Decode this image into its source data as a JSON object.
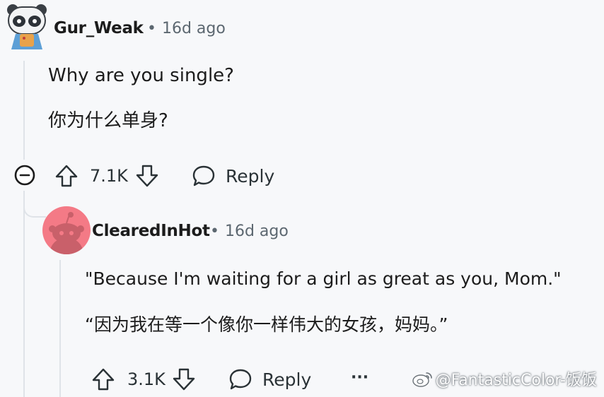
{
  "comment1": {
    "username": "Gur_Weak",
    "time": "16d ago",
    "text_en": "Why are you single?",
    "text_zh": "你为什么单身?",
    "upvotes": "7.1K",
    "reply_label": "Reply"
  },
  "comment2": {
    "username": "ClearedInHot",
    "time": "16d ago",
    "text_en": "\"Because I'm waiting for a girl as great as you, Mom.\"",
    "text_zh": "“因为我在等一个像你一样伟大的女孩，妈妈。”",
    "upvotes": "3.1K",
    "reply_label": "Reply",
    "more_label": "···"
  },
  "watermark": {
    "text": "@FantasticColor-饭饭"
  },
  "colors": {
    "accent_avatar2": "#f47a86",
    "thread_line": "#dfe3e8",
    "meta_text": "#5c6770"
  },
  "icons": {
    "collapse": "minus-circle-icon",
    "upvote": "arrow-up-icon",
    "downvote": "arrow-down-icon",
    "reply": "speech-bubble-icon",
    "weibo": "weibo-icon"
  }
}
